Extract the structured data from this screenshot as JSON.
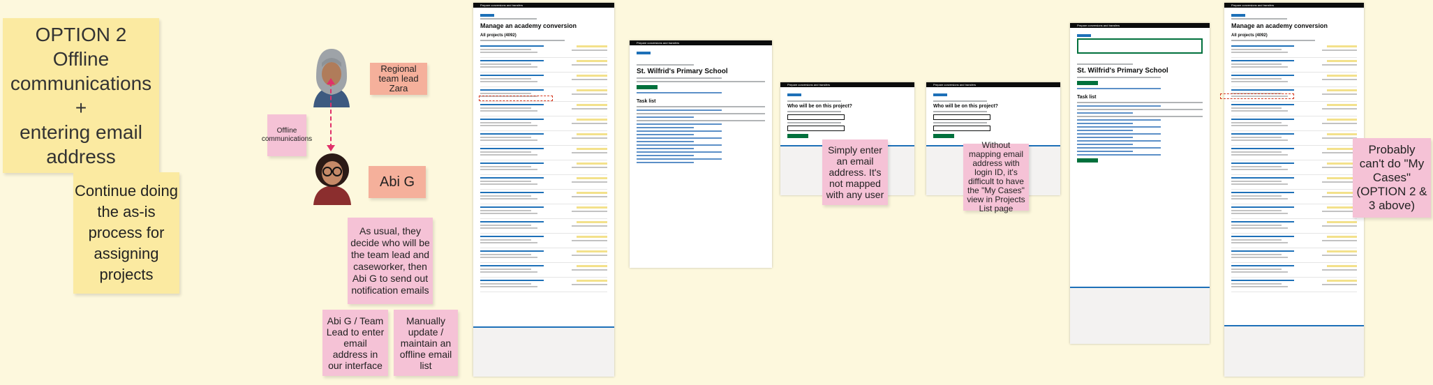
{
  "option_title": "OPTION 2\nOffline communications\n+\nentering email address",
  "continue_note": "Continue doing the as-is process for assigning projects",
  "offline_note": "Offline communications",
  "regional_lead": "Regional team lead Zara",
  "abi_label": "Abi G",
  "as_usual_note": "As usual, they decide who will be the team lead and caseworker, then Abi G to send out notification emails",
  "abi_enter_note": "Abi G / Team Lead to enter email address in our interface",
  "manual_note": "Manually update / maintain an offline email list",
  "simply_note": "Simply enter an email address. It's not mapped with any user",
  "without_mapping_note": "Without mapping email address with login ID, it's difficult to have the \"My Cases\" view in Projects List page",
  "probably_note": "Probably can't do \"My Cases\" (OPTION 2 & 3 above)",
  "screens": {
    "app_name": "Prepare conversions and transfers",
    "manage_title": "Manage an academy conversion",
    "all_projects": "All projects (4092)",
    "school_title": "St. Wilfrid's Primary School",
    "task_list": "Task list",
    "who_will_be": "Who will be on this project?"
  },
  "colors": {
    "background": "#fdf8dd",
    "yellow_sticky": "#fbeaa1",
    "pink_sticky": "#f5c2d6",
    "salmon_sticky": "#f5b09b",
    "link_arrow": "#e0306a"
  },
  "icons": [
    "female-hijab-avatar-icon",
    "female-glasses-avatar-icon"
  ]
}
